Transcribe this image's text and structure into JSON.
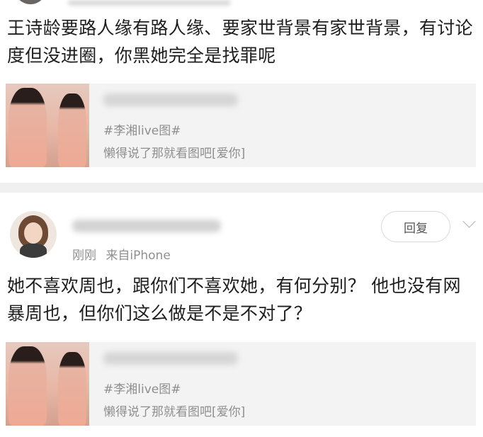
{
  "post1": {
    "text": "王诗龄要路人缘有路人缘、要家世背景有家世背景，有讨论度但没进圈，你黑她完全是找罪呢",
    "card": {
      "tag": "#李湘live图#",
      "desc": "懒得说了那就看图吧[爱你]"
    }
  },
  "post2": {
    "time": "刚刚",
    "source": "来自iPhone",
    "reply_label": "回复",
    "text": "她不喜欢周也，跟你们不喜欢她，有何分别？ 他也没有网暴周也，但你们这么做是不是不对了？",
    "card": {
      "tag": "#李湘live图#",
      "desc": "懒得说了那就看图吧[爱你]"
    }
  },
  "icons": {
    "more": "chevron-down-icon"
  },
  "colors": {
    "meta_gray": "#8f8f8f",
    "card_bg": "#f3f3f3",
    "divider": "#f0f0f0"
  }
}
